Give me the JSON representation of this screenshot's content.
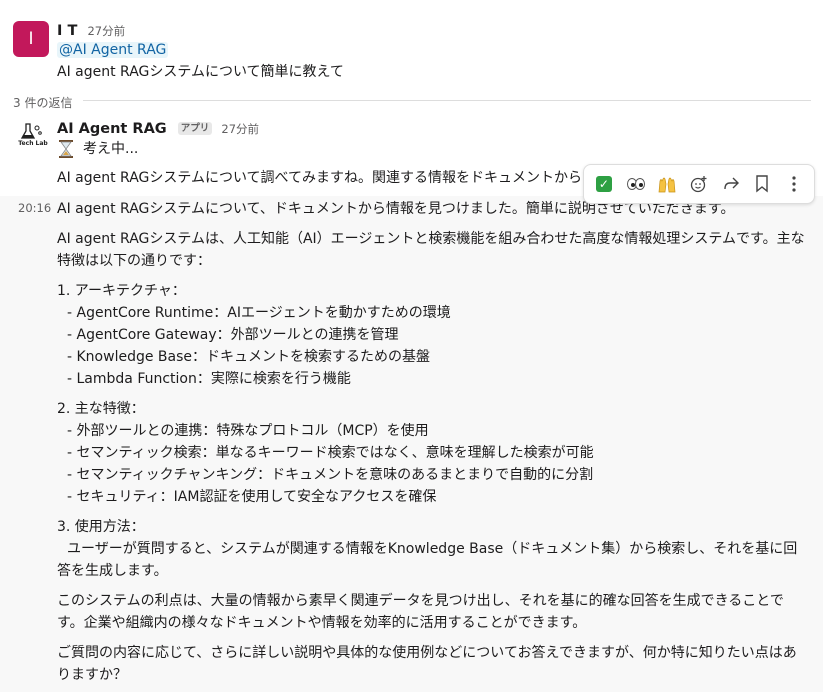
{
  "message1": {
    "user": "I T",
    "avatar_letter": "I",
    "time": "27分前",
    "mention": "@AI Agent RAG",
    "text": "AI agent RAGシステムについて簡単に教えて"
  },
  "replies_label": "3 件の返信",
  "bot": {
    "name": "AI Agent RAG",
    "badge": "アプリ",
    "time": "27分前",
    "logo_text": "Tech Lab",
    "thinking": "考え中...",
    "line1": "AI agent RAGシステムについて調べてみますね。関連する情報をドキュメントから",
    "hover_time": "20:16",
    "line2": "AI agent RAGシステムについて、ドキュメントから情報を見つけました。簡単に説明させていただきます。",
    "intro": "AI agent RAGシステムは、人工知能（AI）エージェントと検索機能を組み合わせた高度な情報処理システムです。主な特徴は以下の通りです：",
    "section1_title": "1. アーキテクチャ：",
    "section1_items": [
      "- AgentCore Runtime：AIエージェントを動かすための環境",
      "- AgentCore Gateway：外部ツールとの連携を管理",
      "- Knowledge Base：ドキュメントを検索するための基盤",
      "- Lambda Function：実際に検索を行う機能"
    ],
    "section2_title": "2. 主な特徴：",
    "section2_items": [
      "- 外部ツールとの連携：特殊なプロトコル（MCP）を使用",
      "- セマンティック検索：単なるキーワード検索ではなく、意味を理解した検索が可能",
      "- セマンティックチャンキング：ドキュメントを意味のあるまとまりで自動的に分割",
      "- セキュリティ：IAM認証を使用して安全なアクセスを確保"
    ],
    "section3_title": "3. 使用方法：",
    "section3_text": "ユーザーが質問すると、システムが関連する情報をKnowledge Base（ドキュメント集）から検索し、それを基に回答を生成します。",
    "benefit": "このシステムの利点は、大量の情報から素早く関連データを見つけ出し、それを基に的確な回答を生成できることです。企業や組織内の様々なドキュメントや情報を効率的に活用することができます。",
    "closing": "ご質問の内容に応じて、さらに詳しい説明や具体的な使用例などについてお答えできますが、何か特に知りたい点はありますか？"
  },
  "toolbar_icons": [
    "check-mark-reaction",
    "eyes-reaction",
    "raised-hands-reaction",
    "add-reaction",
    "share",
    "bookmark",
    "more-actions"
  ],
  "colors": {
    "avatar": "#c2185b",
    "mention": "#1264a3",
    "check": "#2ea043"
  }
}
